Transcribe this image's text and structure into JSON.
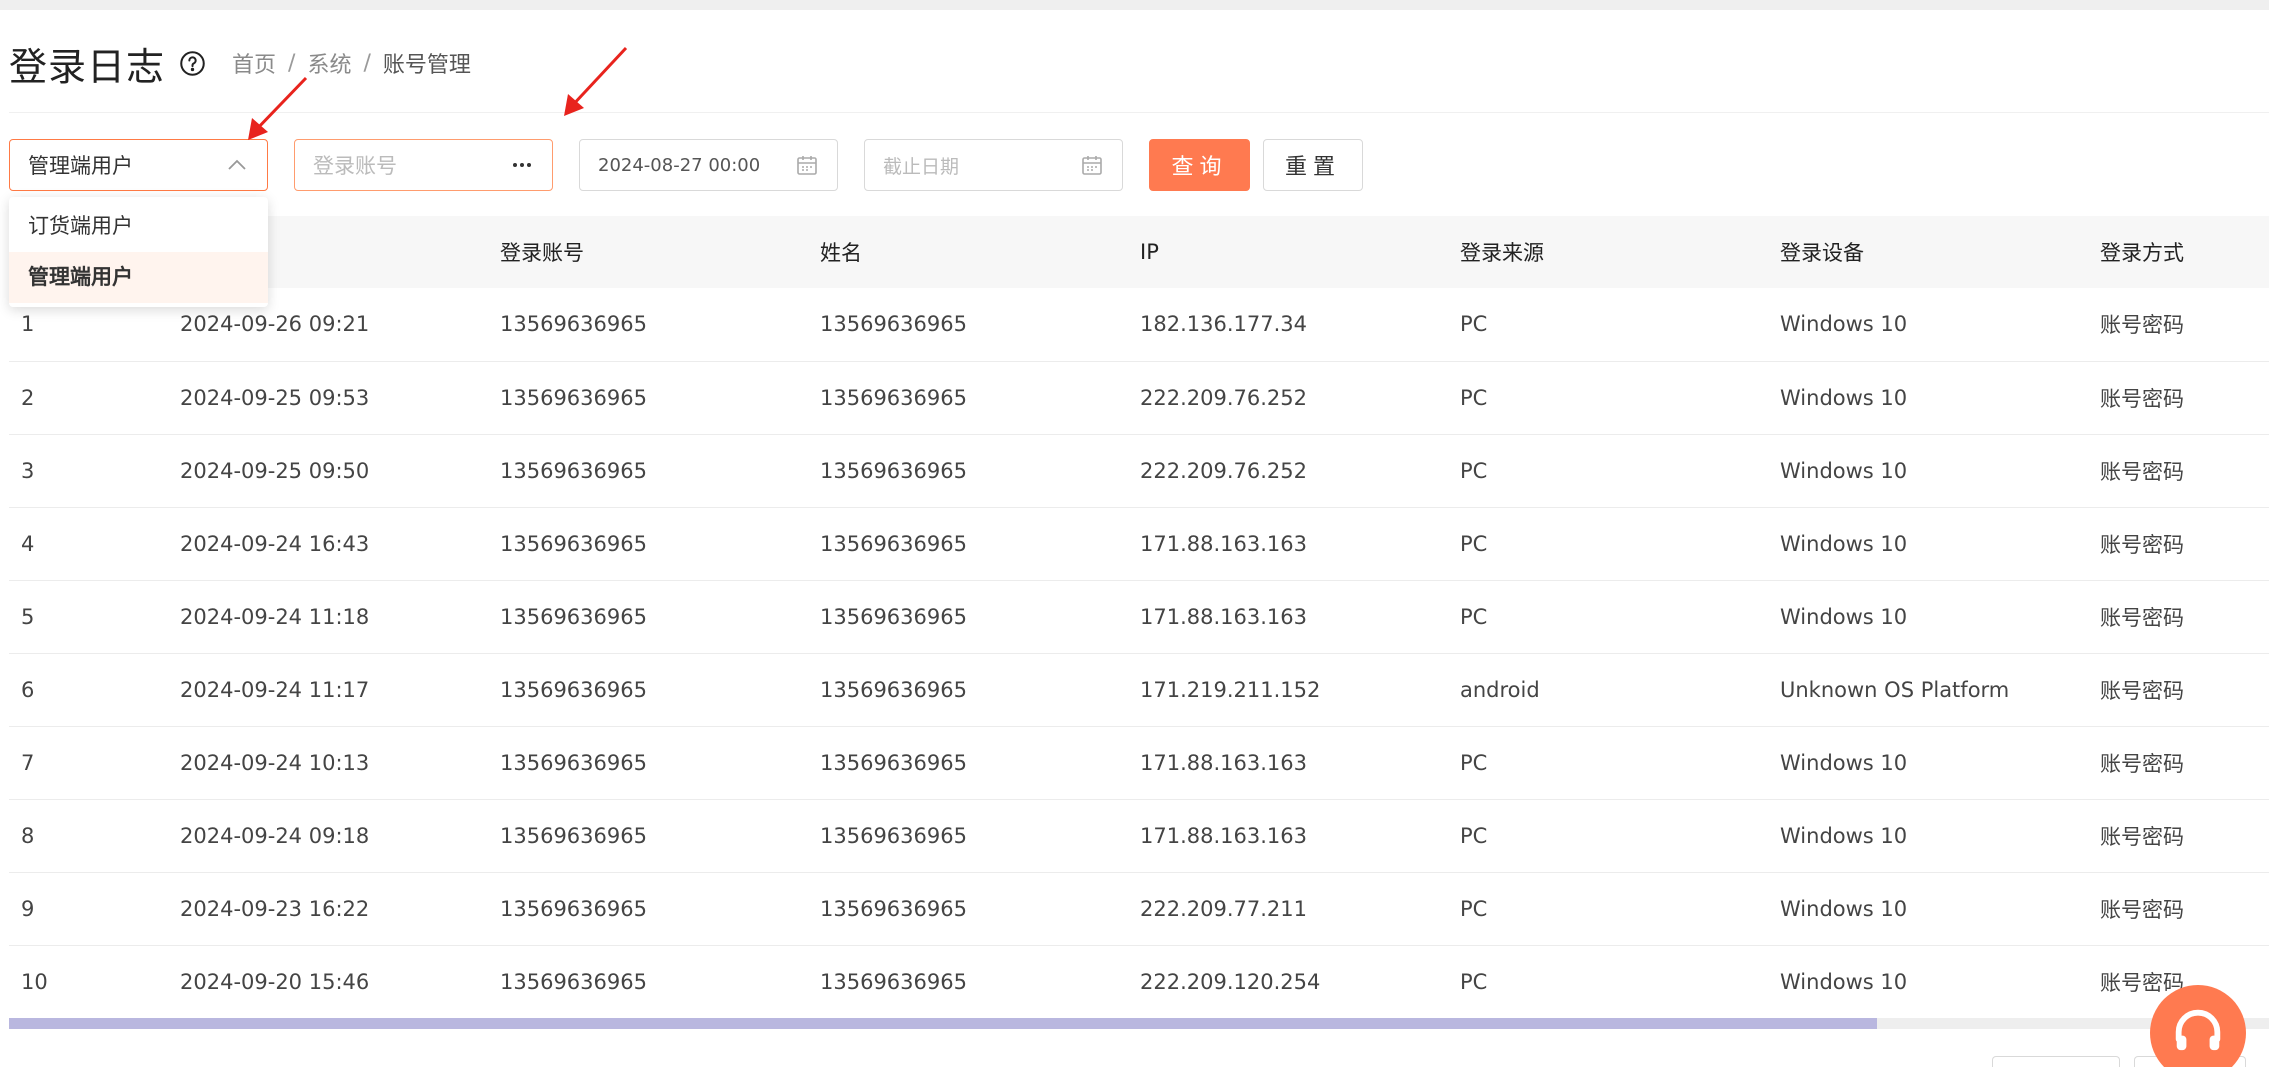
{
  "header": {
    "title": "登录日志",
    "breadcrumb": [
      "首页",
      "系统",
      "账号管理"
    ],
    "separator": "/"
  },
  "filters": {
    "user_type_value": "管理端用户",
    "account_placeholder": "登录账号",
    "start_date_value": "2024-08-27 00:00",
    "end_date_placeholder": "截止日期",
    "query_label": "查询",
    "reset_label": "重置"
  },
  "dropdown": {
    "options": [
      {
        "label": "订货端用户",
        "selected": false
      },
      {
        "label": "管理端用户",
        "selected": true
      }
    ]
  },
  "table": {
    "columns": [
      "",
      "",
      "登录账号",
      "姓名",
      "IP",
      "登录来源",
      "登录设备",
      "登录方式"
    ],
    "rows": [
      [
        "1",
        "2024-09-26 09:21",
        "13569636965",
        "13569636965",
        "182.136.177.34",
        "PC",
        "Windows 10",
        "账号密码"
      ],
      [
        "2",
        "2024-09-25 09:53",
        "13569636965",
        "13569636965",
        "222.209.76.252",
        "PC",
        "Windows 10",
        "账号密码"
      ],
      [
        "3",
        "2024-09-25 09:50",
        "13569636965",
        "13569636965",
        "222.209.76.252",
        "PC",
        "Windows 10",
        "账号密码"
      ],
      [
        "4",
        "2024-09-24 16:43",
        "13569636965",
        "13569636965",
        "171.88.163.163",
        "PC",
        "Windows 10",
        "账号密码"
      ],
      [
        "5",
        "2024-09-24 11:18",
        "13569636965",
        "13569636965",
        "171.88.163.163",
        "PC",
        "Windows 10",
        "账号密码"
      ],
      [
        "6",
        "2024-09-24 11:17",
        "13569636965",
        "13569636965",
        "171.219.211.152",
        "android",
        "Unknown OS Platform",
        "账号密码"
      ],
      [
        "7",
        "2024-09-24 10:13",
        "13569636965",
        "13569636965",
        "171.88.163.163",
        "PC",
        "Windows 10",
        "账号密码"
      ],
      [
        "8",
        "2024-09-24 09:18",
        "13569636965",
        "13569636965",
        "171.88.163.163",
        "PC",
        "Windows 10",
        "账号密码"
      ],
      [
        "9",
        "2024-09-23 16:22",
        "13569636965",
        "13569636965",
        "222.209.77.211",
        "PC",
        "Windows 10",
        "账号密码"
      ],
      [
        "10",
        "2024-09-20 15:46",
        "13569636965",
        "13569636965",
        "222.209.120.254",
        "PC",
        "Windows 10",
        "账号密码"
      ]
    ]
  },
  "icons": {
    "help": "question-circle-icon",
    "select_caret": "chevron-up-icon",
    "account_more": "ellipsis-icon",
    "date": "calendar-icon",
    "support": "headset-icon",
    "annotation": "red-arrow-icon"
  },
  "colors": {
    "accent": "#ff7a50",
    "annotation_arrow": "#e8231d",
    "scrollbar_thumb": "#b9b7df",
    "dropdown_selected_bg": "#fff4ee"
  },
  "scroll": {
    "horizontal_position_fraction": 0.83
  }
}
